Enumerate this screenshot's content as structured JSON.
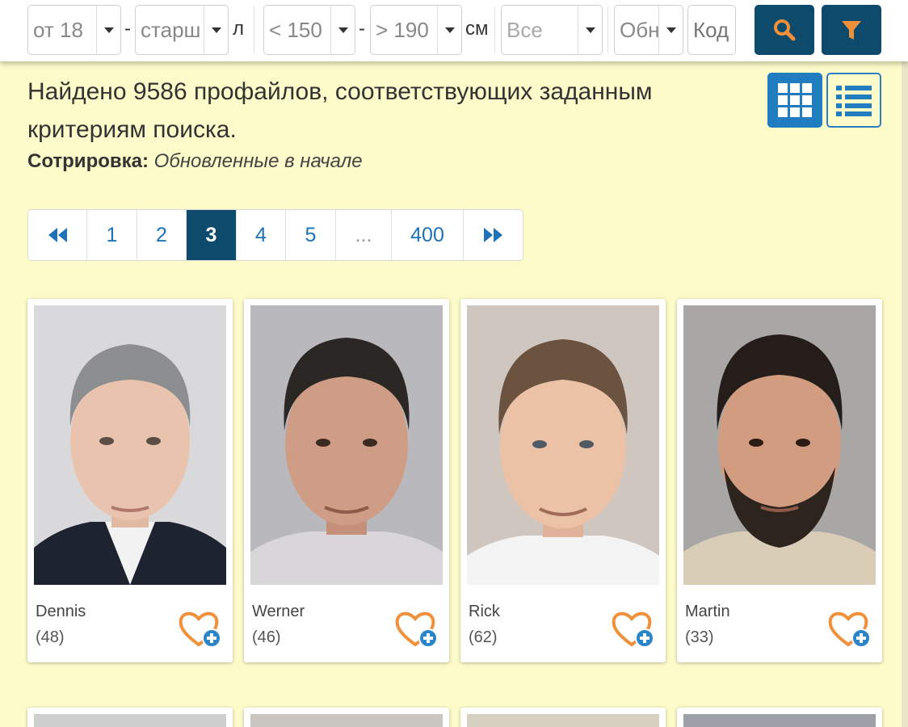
{
  "filters": {
    "age_from": "от 18",
    "age_dash": "-",
    "age_to": "старш",
    "age_unit": "л",
    "height_from": "< 150",
    "height_dash": "-",
    "height_to": "> 190",
    "height_unit": "см",
    "category": "Все",
    "sort_short": "Обн",
    "code_placeholder": "Код",
    "search_icon": "search-icon",
    "filter_icon": "filter-icon"
  },
  "results": {
    "found_text": "Найдено 9586 профайлов, соответствующих заданным критериям поиска.",
    "sort_label": "Сотрировка:",
    "sort_value": "Обновленные в начале"
  },
  "view": {
    "grid_icon": "grid-view-icon",
    "list_icon": "list-view-icon",
    "active": "grid"
  },
  "pagination": {
    "first_icon": "double-chevron-left-icon",
    "pages": [
      "1",
      "2",
      "3",
      "4",
      "5",
      "...",
      "400"
    ],
    "current": "3",
    "last_icon": "double-chevron-right-icon"
  },
  "profiles": [
    {
      "name": "Dennis",
      "age": "(48)"
    },
    {
      "name": "Werner",
      "age": "(46)"
    },
    {
      "name": "Rick",
      "age": "(62)"
    },
    {
      "name": "Martin",
      "age": "(33)"
    }
  ],
  "colors": {
    "page_bg": "#fdfbc9",
    "dark_button": "#0e4a6b",
    "accent_blue": "#1f7dc0",
    "heart_orange": "#f0903a"
  }
}
